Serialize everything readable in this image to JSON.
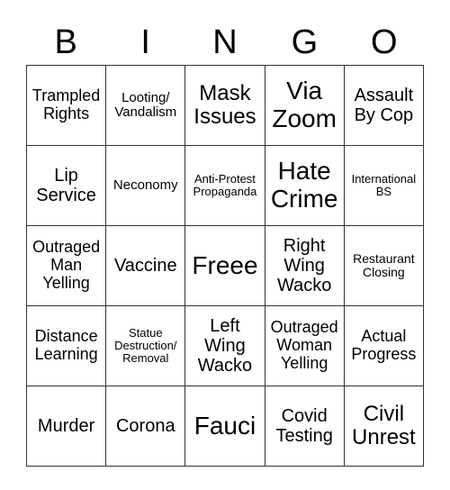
{
  "header": {
    "letters": [
      "B",
      "I",
      "N",
      "G",
      "O"
    ]
  },
  "grid": {
    "rows": [
      [
        {
          "text": "Trampled\nRights",
          "size": "ms"
        },
        {
          "text": "Looting/\nVandalism",
          "size": "s"
        },
        {
          "text": "Mask\nIssues",
          "size": "l"
        },
        {
          "text": "Via\nZoom",
          "size": "xl"
        },
        {
          "text": "Assault\nBy Cop",
          "size": "m"
        }
      ],
      [
        {
          "text": "Lip\nService",
          "size": "m"
        },
        {
          "text": "Neconomy",
          "size": "s"
        },
        {
          "text": "Anti-Protest\nPropaganda",
          "size": "xxs"
        },
        {
          "text": "Hate\nCrime",
          "size": "xl"
        },
        {
          "text": "International\nBS",
          "size": "xxs"
        }
      ],
      [
        {
          "text": "Outraged\nMan\nYelling",
          "size": "ms"
        },
        {
          "text": "Vaccine",
          "size": "m"
        },
        {
          "text": "Freee",
          "size": "xl"
        },
        {
          "text": "Right\nWing\nWacko",
          "size": "m"
        },
        {
          "text": "Restaurant\nClosing",
          "size": "xs"
        }
      ],
      [
        {
          "text": "Distance\nLearning",
          "size": "ms"
        },
        {
          "text": "Statue\nDestruction/\nRemoval",
          "size": "xxs"
        },
        {
          "text": "Left\nWing\nWacko",
          "size": "m"
        },
        {
          "text": "Outraged\nWoman\nYelling",
          "size": "ms"
        },
        {
          "text": "Actual\nProgress",
          "size": "ms"
        }
      ],
      [
        {
          "text": "Murder",
          "size": "m"
        },
        {
          "text": "Corona",
          "size": "m"
        },
        {
          "text": "Fauci",
          "size": "xl"
        },
        {
          "text": "Covid\nTesting",
          "size": "m"
        },
        {
          "text": "Civil\nUnrest",
          "size": "l"
        }
      ]
    ]
  }
}
